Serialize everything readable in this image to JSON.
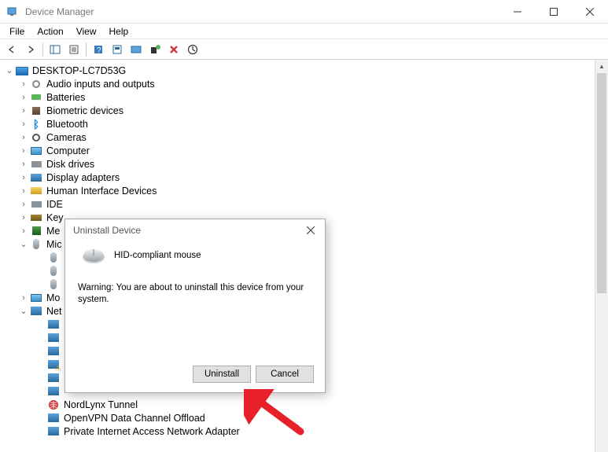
{
  "window": {
    "title": "Device Manager"
  },
  "menu": {
    "file": "File",
    "action": "Action",
    "view": "View",
    "help": "Help"
  },
  "tree": {
    "root": "DESKTOP-LC7D53G",
    "items": [
      {
        "label": "Audio inputs and outputs",
        "icon": "sound"
      },
      {
        "label": "Batteries",
        "icon": "battery"
      },
      {
        "label": "Biometric devices",
        "icon": "bio"
      },
      {
        "label": "Bluetooth",
        "icon": "bluetooth"
      },
      {
        "label": "Cameras",
        "icon": "camera"
      },
      {
        "label": "Computer",
        "icon": "computer"
      },
      {
        "label": "Disk drives",
        "icon": "disk"
      },
      {
        "label": "Display adapters",
        "icon": "display"
      },
      {
        "label": "Human Interface Devices",
        "icon": "hid"
      },
      {
        "label": "IDE",
        "icon": "ide",
        "truncated": true
      },
      {
        "label": "Key",
        "icon": "keyboard",
        "truncated": true
      },
      {
        "label": "Me",
        "icon": "mem",
        "truncated": true
      },
      {
        "label": "Mic",
        "icon": "mouse",
        "truncated": true,
        "expanded": true
      },
      {
        "label": "Mo",
        "icon": "monitor",
        "truncated": true
      },
      {
        "label": "Net",
        "icon": "network",
        "truncated": true,
        "expanded": true
      }
    ],
    "net_children": [
      {
        "icon": "net"
      },
      {
        "icon": "net"
      },
      {
        "icon": "net"
      },
      {
        "icon": "net",
        "warn": true
      },
      {
        "icon": "net"
      },
      {
        "icon": "net"
      }
    ],
    "visible_net_tail": [
      "NordLynx Tunnel",
      "OpenVPN Data Channel Offload",
      "Private Internet Access Network Adapter"
    ],
    "nordlynx_icon": "globe-red"
  },
  "dialog": {
    "title": "Uninstall Device",
    "device_name": "HID-compliant mouse",
    "warning": "Warning: You are about to uninstall this device from your system.",
    "uninstall": "Uninstall",
    "cancel": "Cancel"
  }
}
